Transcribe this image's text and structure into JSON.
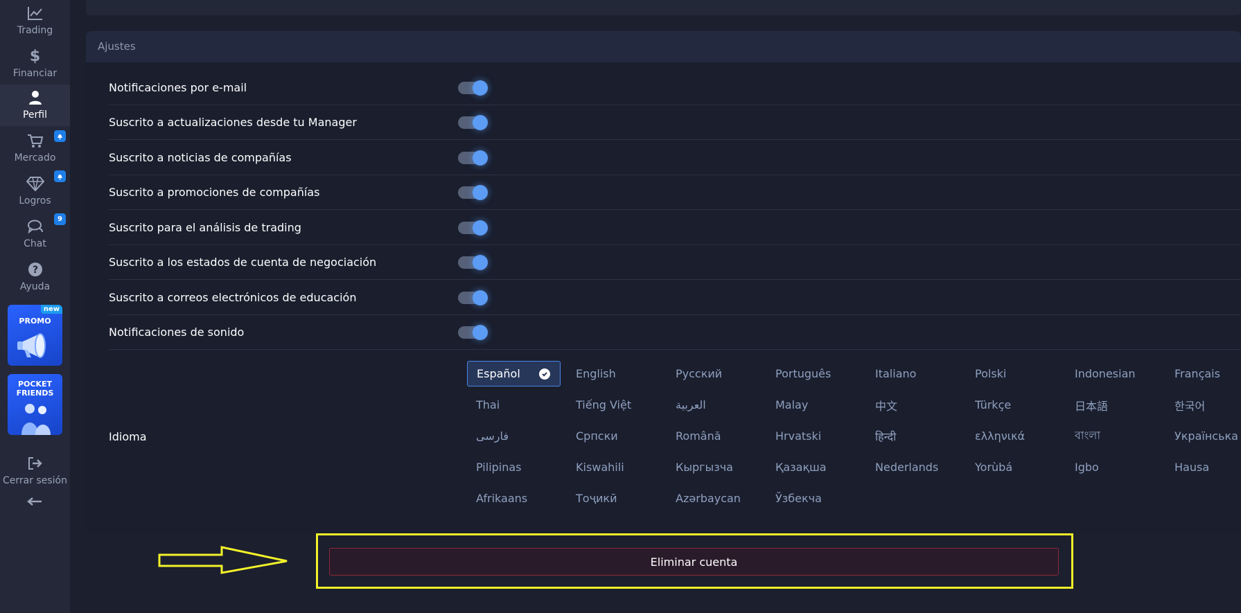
{
  "sidebar": {
    "items": [
      {
        "label": "Trading",
        "icon": "chart-line-icon"
      },
      {
        "label": "Financiar",
        "icon": "dollar-icon"
      },
      {
        "label": "Perfil",
        "icon": "user-icon"
      },
      {
        "label": "Mercado",
        "icon": "cart-icon",
        "badge": "bell"
      },
      {
        "label": "Logros",
        "icon": "diamond-icon",
        "badge": "bell"
      },
      {
        "label": "Chat",
        "icon": "chat-icon",
        "badge": "9"
      },
      {
        "label": "Ayuda",
        "icon": "help-icon"
      }
    ],
    "promo": {
      "label": "PROMO",
      "badge": "new"
    },
    "friends": {
      "label_line1": "POCKET",
      "label_line2": "FRIENDS"
    },
    "logout": {
      "label": "Cerrar sesión"
    },
    "collapse_icon": "arrow-left-icon"
  },
  "settings": {
    "title": "Ajustes",
    "toggles": [
      {
        "label": "Notificaciones por e-mail",
        "on": true
      },
      {
        "label": "Suscrito a actualizaciones desde tu Manager",
        "on": true
      },
      {
        "label": "Suscrito a noticias de compañías",
        "on": true
      },
      {
        "label": "Suscrito a promociones de compañías",
        "on": true
      },
      {
        "label": "Suscrito para el análisis de trading",
        "on": true
      },
      {
        "label": "Suscrito a los estados de cuenta de negociación",
        "on": true
      },
      {
        "label": "Suscrito a correos electrónicos de educación",
        "on": true
      },
      {
        "label": "Notificaciones de sonido",
        "on": true
      }
    ],
    "language_label": "Idioma",
    "languages": [
      "Español",
      "English",
      "Русский",
      "Português",
      "Italiano",
      "Polski",
      "Indonesian",
      "Français",
      "Thai",
      "Tiếng Việt",
      "العربية",
      "Malay",
      "中文",
      "Türkçe",
      "日本語",
      "한국어",
      "فارسی",
      "Српски",
      "Română",
      "Hrvatski",
      "हिन्दी",
      "ελληνικά",
      "বাংলা",
      "Українська",
      "Pilipinas",
      "Kiswahili",
      "Кыргызча",
      "Қазақша",
      "Nederlands",
      "Yorùbá",
      "Igbo",
      "Hausa",
      "Afrikaans",
      "Тоҷикӣ",
      "Azərbaycan",
      "Ўзбекча"
    ],
    "selected_language": "Español"
  },
  "delete_account": {
    "label": "Eliminar cuenta"
  },
  "colors": {
    "accent": "#5c9cf5",
    "highlight": "#f2f22a",
    "danger_border": "#8a2a3a"
  }
}
